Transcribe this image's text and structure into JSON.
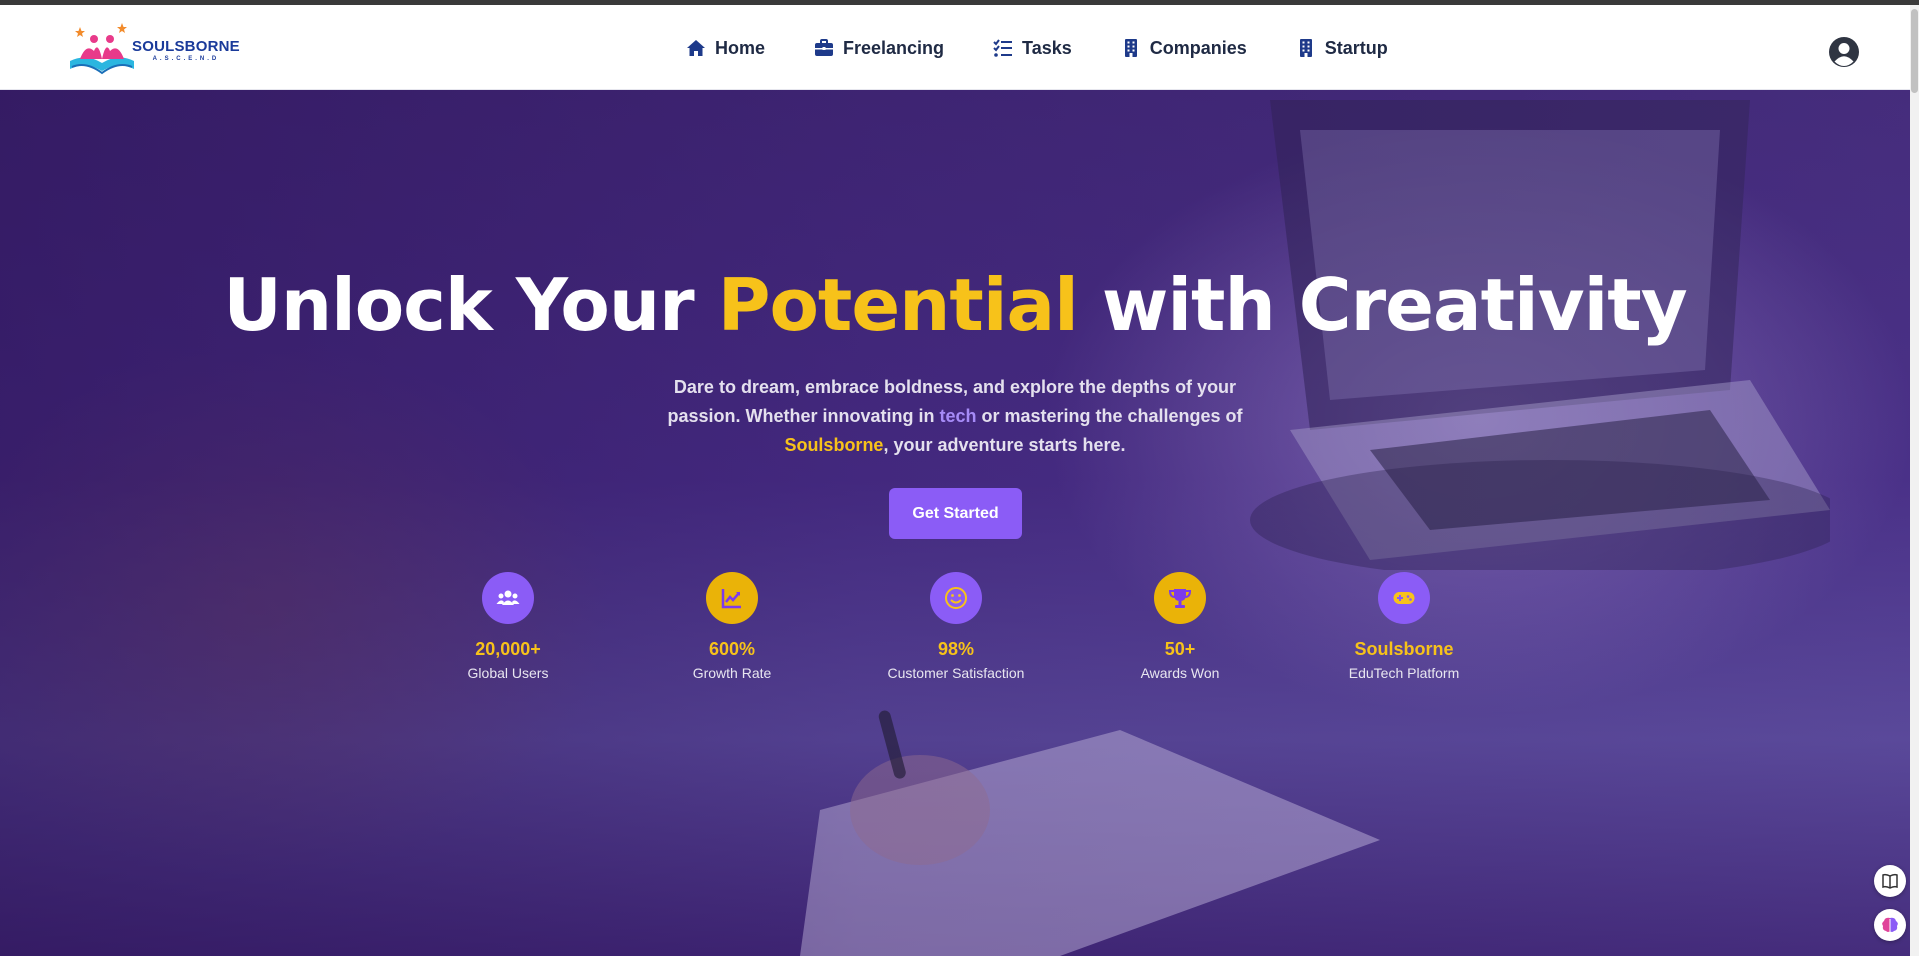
{
  "brand": {
    "name": "SOULSBORNE",
    "tagline": "A.S.C.E.N.D"
  },
  "nav": {
    "items": [
      {
        "label": "Home",
        "icon": "home-icon"
      },
      {
        "label": "Freelancing",
        "icon": "briefcase-icon"
      },
      {
        "label": "Tasks",
        "icon": "tasks-list-icon"
      },
      {
        "label": "Companies",
        "icon": "building-icon"
      },
      {
        "label": "Startup",
        "icon": "building-icon"
      }
    ],
    "account_icon": "user-circle-icon"
  },
  "hero": {
    "headline_part1": "Unlock Your ",
    "headline_accent": "Potential",
    "headline_part2": " with Creativity",
    "sub_part1": "Dare to dream, embrace boldness, and explore the depths of your passion. Whether innovating in ",
    "sub_tech": "tech",
    "sub_part2": " or mastering the challenges of ",
    "sub_brand": "Soulsborne",
    "sub_part3": ", your adventure starts here.",
    "cta_label": "Get Started"
  },
  "stats": [
    {
      "value": "20,000+",
      "label": "Global Users",
      "icon": "users-icon",
      "color": "#8b5cf6"
    },
    {
      "value": "600%",
      "label": "Growth Rate",
      "icon": "chart-line-icon",
      "color": "#eab308"
    },
    {
      "value": "98%",
      "label": "Customer Satisfaction",
      "icon": "smile-icon",
      "color": "#8b5cf6"
    },
    {
      "value": "50+",
      "label": "Awards Won",
      "icon": "trophy-icon",
      "color": "#eab308"
    },
    {
      "value": "Soulsborne",
      "label": "EduTech Platform",
      "icon": "gamepad-icon",
      "color": "#8b5cf6"
    }
  ],
  "floating": [
    {
      "icon": "book-icon"
    },
    {
      "icon": "brain-icon"
    }
  ],
  "colors": {
    "accent_yellow": "#f7c21a",
    "accent_purple": "#8b5cf6",
    "nav_text": "#1f2a44"
  }
}
